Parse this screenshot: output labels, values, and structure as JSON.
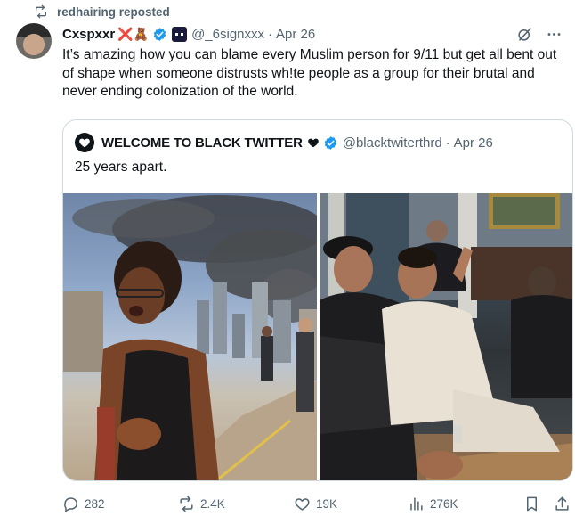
{
  "repost": {
    "text": "redhairing reposted",
    "icon": "repost-icon"
  },
  "tweet": {
    "author_name": "Cxspxxr",
    "author_emoji": "❌🧸",
    "handle": "@_6signxxx",
    "date": "Apr 26",
    "text": "It’s amazing how you can blame every Muslim person for 9/11 but get all bent out of shape when someone distrusts wh!te people as a group for their brutal and never ending colonization of the world."
  },
  "quote": {
    "author_name": "WELCOME TO BLACK TWITTER",
    "handle": "@blacktwiterthrd",
    "date": "Apr 26",
    "text": "25 years apart."
  },
  "actions": {
    "replies": "282",
    "reposts": "2.4K",
    "likes": "19K",
    "views": "276K"
  },
  "colors": {
    "text": "#0f1419",
    "muted": "#536471",
    "verified": "#1d9bf0",
    "border": "#cfd9de"
  }
}
